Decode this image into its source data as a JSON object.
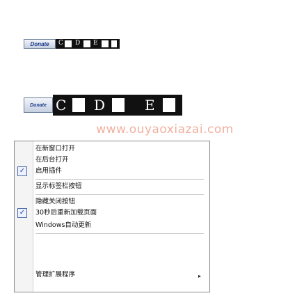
{
  "toolbar_small": {
    "donate_label": "Donate",
    "letters": [
      "C",
      "D",
      "E"
    ]
  },
  "toolbar_large": {
    "donate_label": "Donate",
    "letters": [
      "C",
      "D",
      "E"
    ]
  },
  "watermark": "www.ouyaoxiazai.com",
  "context_menu": {
    "items": [
      {
        "label": "在新窗口打开",
        "checked": false
      },
      {
        "label": "在后台打开",
        "checked": false
      },
      {
        "label": "启用插件",
        "checked": true
      },
      {
        "label": "显示标签栏按钮",
        "checked": false
      },
      {
        "label": "隐藏关闭按钮",
        "checked": false
      },
      {
        "label": "30秒后重新加载页面",
        "checked": true
      },
      {
        "label": "Windows自动更新",
        "checked": false
      },
      {
        "label": "管理扩展程序",
        "checked": false,
        "submenu": true
      }
    ],
    "check_glyph": "✓",
    "submenu_glyph": "▸"
  },
  "colors": {
    "watermark": "#f0b0a0",
    "check_border": "#4a6aaa"
  }
}
